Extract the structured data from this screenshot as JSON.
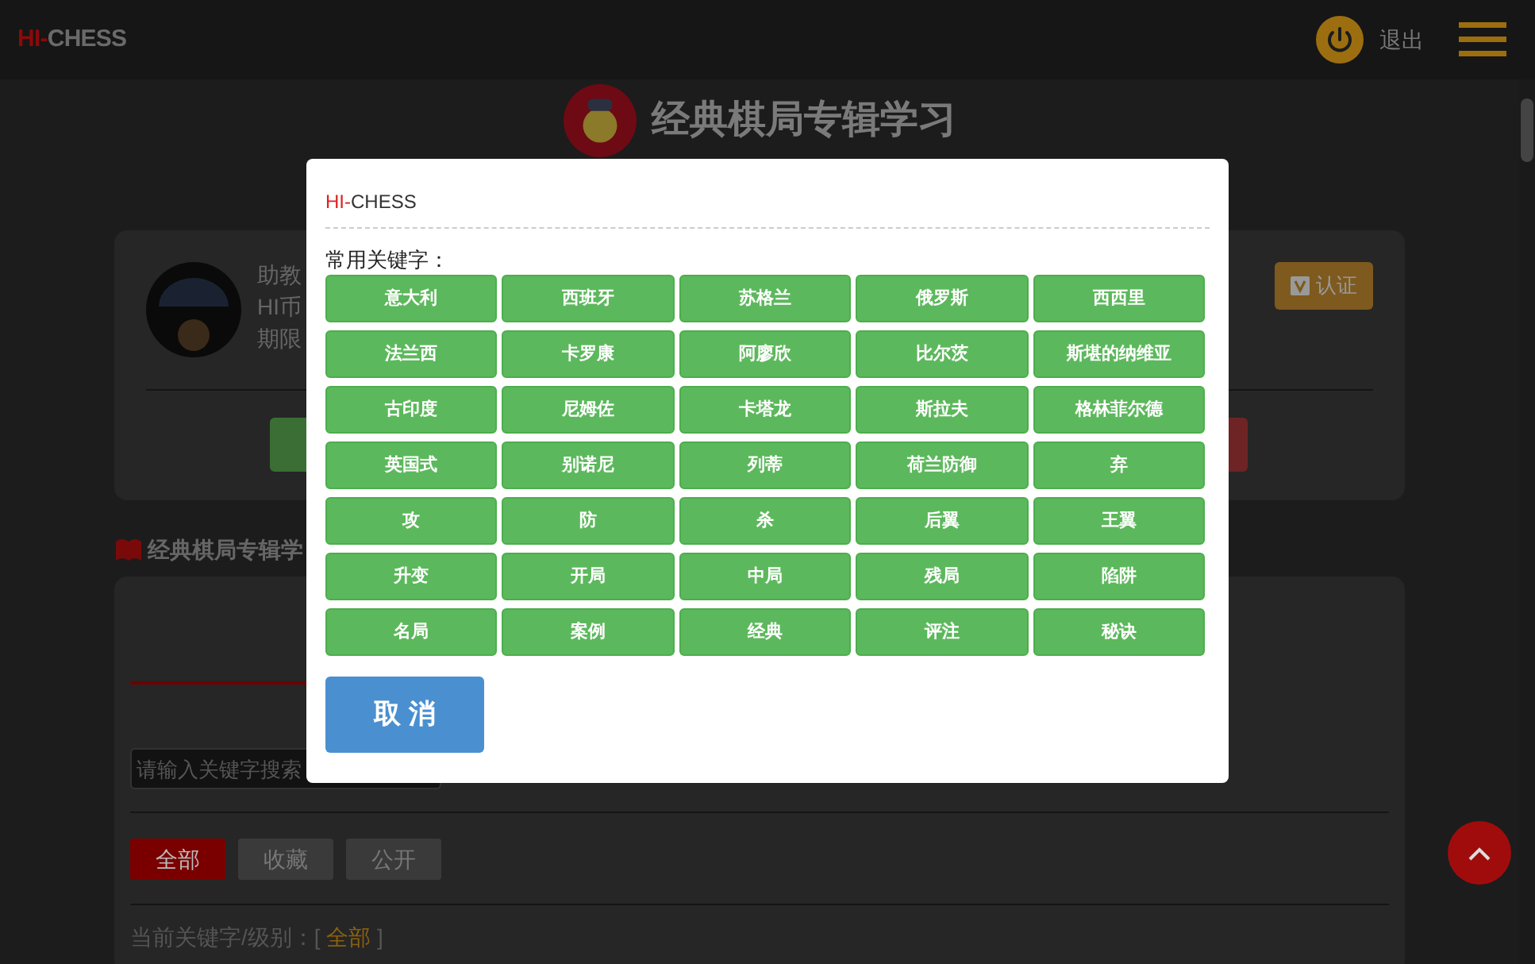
{
  "header": {
    "logo_prefix": "HI-",
    "logo_suffix": "CHESS",
    "logout": "退出"
  },
  "page_title": "经典棋局专辑学习",
  "profile": {
    "lines": [
      "助教",
      "HI币",
      "期限"
    ],
    "verify_button": "认证"
  },
  "section_title": "经典棋局专辑学",
  "search": {
    "placeholder": "请输入关键字搜索"
  },
  "filter_tabs": [
    {
      "label": "全部",
      "selected": true
    },
    {
      "label": "收藏",
      "selected": false
    },
    {
      "label": "公开",
      "selected": false
    }
  ],
  "current_filter": {
    "label": "当前关键字/级别：[",
    "value": "全部",
    "suffix": "]"
  },
  "dialog": {
    "title_prefix": "HI-",
    "title_suffix": "CHESS",
    "heading": "常用关键字：",
    "keywords": [
      "意大利",
      "西班牙",
      "苏格兰",
      "俄罗斯",
      "西西里",
      "法兰西",
      "卡罗康",
      "阿廖欣",
      "比尔茨",
      "斯堪的纳维亚",
      "古印度",
      "尼姆佐",
      "卡塔龙",
      "斯拉夫",
      "格林菲尔德",
      "英国式",
      "别诺尼",
      "列蒂",
      "荷兰防御",
      "弃",
      "攻",
      "防",
      "杀",
      "后翼",
      "王翼",
      "升变",
      "开局",
      "中局",
      "残局",
      "陷阱",
      "名局",
      "案例",
      "经典",
      "评注",
      "秘诀"
    ],
    "cancel_button": "取 消"
  }
}
